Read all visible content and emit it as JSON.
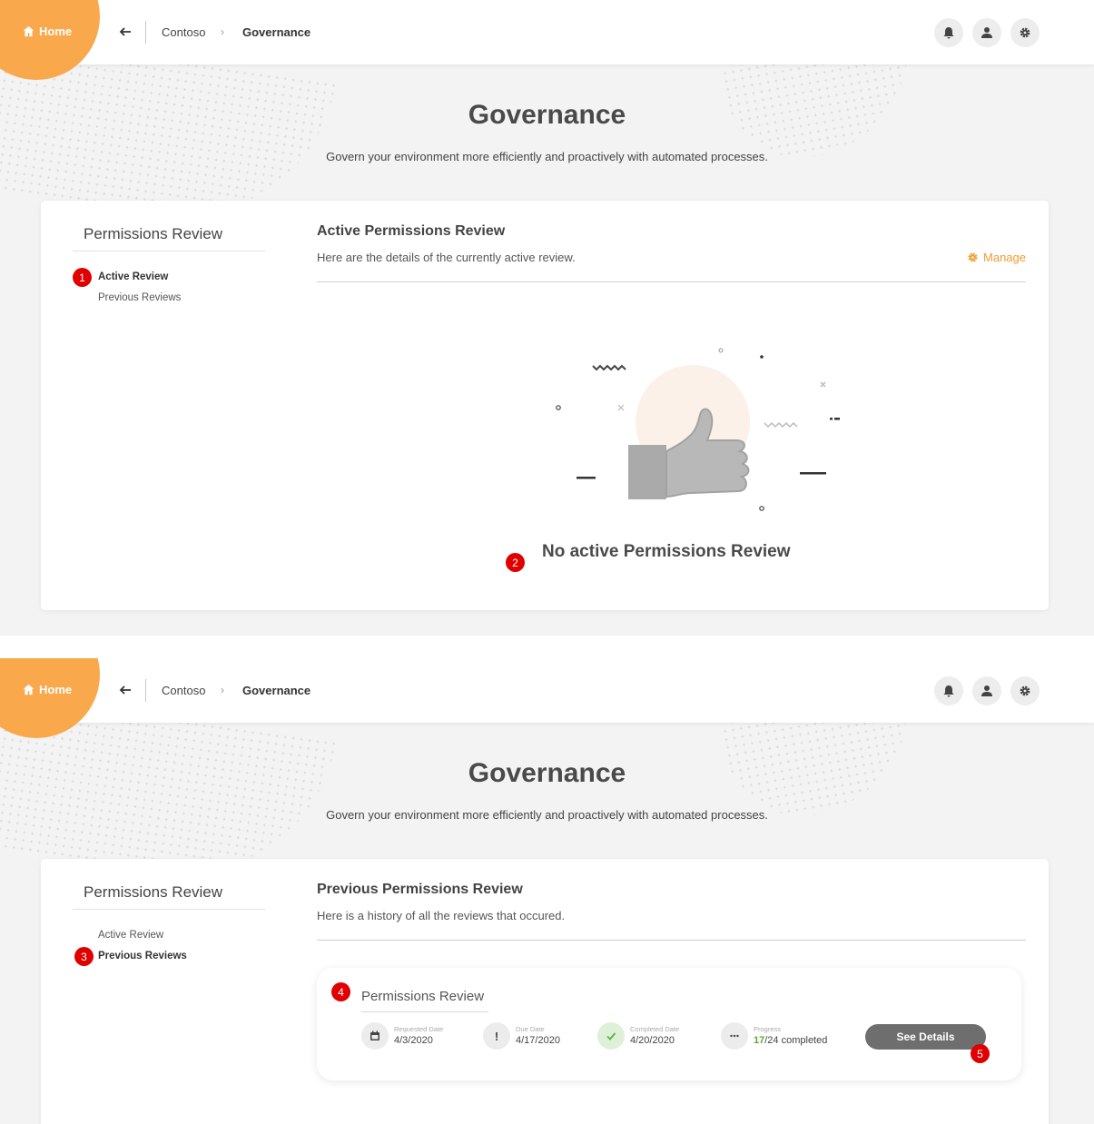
{
  "nav": {
    "home_label": "Home",
    "breadcrumb_parent": "Contoso",
    "breadcrumb_sep": "›",
    "breadcrumb_current": "Governance",
    "icons": [
      "bell-icon",
      "user-icon",
      "gear-icon"
    ]
  },
  "page": {
    "title": "Governance",
    "subtitle": "Govern your environment more efficiently and proactively with automated processes."
  },
  "sidebar": {
    "title": "Permissions Review",
    "items": [
      {
        "label": "Active Review"
      },
      {
        "label": "Previous Reviews"
      }
    ]
  },
  "active_view": {
    "title": "Active Permissions Review",
    "subtitle": "Here are the details of the currently active review.",
    "manage_label": "Manage",
    "empty_message": "No active Permissions Review"
  },
  "previous_view": {
    "title": "Previous Permissions Review",
    "subtitle": "Here is a history of all the reviews that occured.",
    "review": {
      "title": "Permissions Review",
      "requested_label": "Requested Date",
      "requested_value": "4/3/2020",
      "due_label": "Due Date",
      "due_value": "4/17/2020",
      "completed_label": "Completed Date",
      "completed_value": "4/20/2020",
      "progress_label": "Progress",
      "progress_done": "17",
      "progress_total": "/24 completed",
      "details_label": "See Details"
    }
  },
  "badges": [
    "1",
    "2",
    "3",
    "4",
    "5"
  ],
  "colors": {
    "accent": "#f9a84b",
    "manage": "#f29a2e",
    "badge": "#e00000",
    "progress_green": "#5aa832"
  }
}
